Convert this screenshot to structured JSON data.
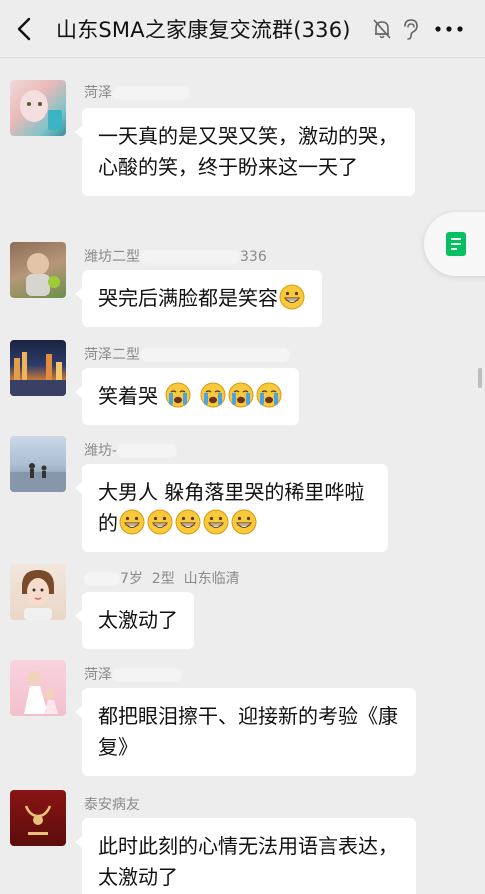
{
  "header": {
    "title": "山东SMA之家康复交流群(336)"
  },
  "messages": [
    {
      "sender": "菏泽",
      "text": "一天真的是又哭又笑，激动的哭，心酸的笑，终于盼来这一天了",
      "emoji_count": 0
    },
    {
      "sender": "潍坊二型",
      "sender_suffix": "336",
      "text": "哭完后满脸都是笑容",
      "emoji": "grinning-face",
      "emoji_count": 1
    },
    {
      "sender": "菏泽二型",
      "text": "笑着哭",
      "emoji": "crying-face",
      "emoji_count": 4
    },
    {
      "sender": "潍坊-",
      "text": "大男人 躲角落里哭的稀里哗啦的",
      "emoji": "grinning-face",
      "emoji_count": 5
    },
    {
      "sender": "7岁  2型  山东临清",
      "text": "太激动了",
      "emoji_count": 0
    },
    {
      "sender": "菏泽",
      "text": "都把眼泪擦干、迎接新的考验《康复》",
      "emoji_count": 0
    },
    {
      "sender": "泰安病友",
      "text": "此时此刻的心情无法用语言表达，太激动了",
      "emoji_count": 0
    }
  ],
  "colors": {
    "background": "#ededed",
    "bubble": "#ffffff",
    "sender_name": "#8a8a8a",
    "widget_accent": "#07c160"
  },
  "icons": [
    "back-arrow-icon",
    "mute-bell-icon",
    "ear-icon",
    "more-icon",
    "document-icon",
    "grinning-face-icon",
    "crying-face-icon"
  ]
}
